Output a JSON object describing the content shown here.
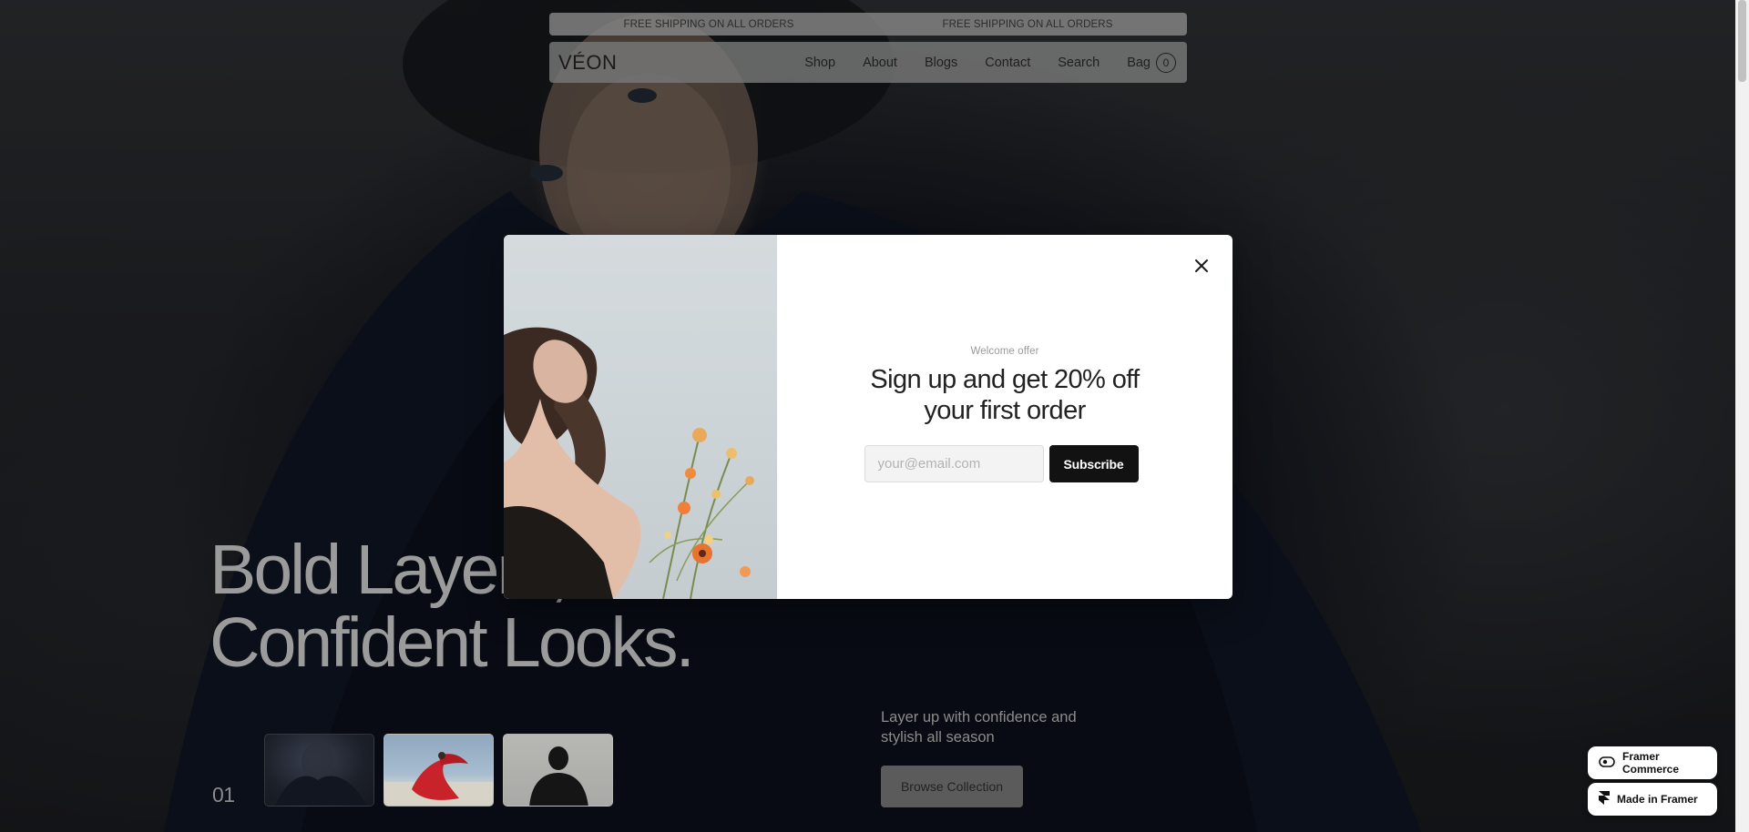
{
  "announcement": {
    "left_text": "FREE SHIPPING ON ALL ORDERS",
    "right_text": "FREE SHIPPING ON ALL ORDERS"
  },
  "nav": {
    "logo": "VÉON",
    "links": [
      "Shop",
      "About",
      "Blogs",
      "Contact",
      "Search"
    ],
    "bag_label": "Bag",
    "bag_count": "0"
  },
  "hero": {
    "title_line1": "Bold Layers,",
    "title_line2": "Confident Looks.",
    "slide_number": "01",
    "subtitle": "Layer up with confidence and stylish all season",
    "cta_label": "Browse Collection"
  },
  "modal": {
    "eyebrow": "Welcome offer",
    "title_line1": "Sign up and get 20% off",
    "title_line2": "your first order",
    "email_placeholder": "your@email.com",
    "subscribe_label": "Subscribe",
    "close_icon": "close-icon"
  },
  "badges": {
    "commerce_label": "Framer Commerce",
    "framer_label": "Made in Framer"
  },
  "colors": {
    "modal_bg": "#ffffff",
    "button_dark": "#121212",
    "overlay": "rgba(0,0,0,0.42)"
  }
}
